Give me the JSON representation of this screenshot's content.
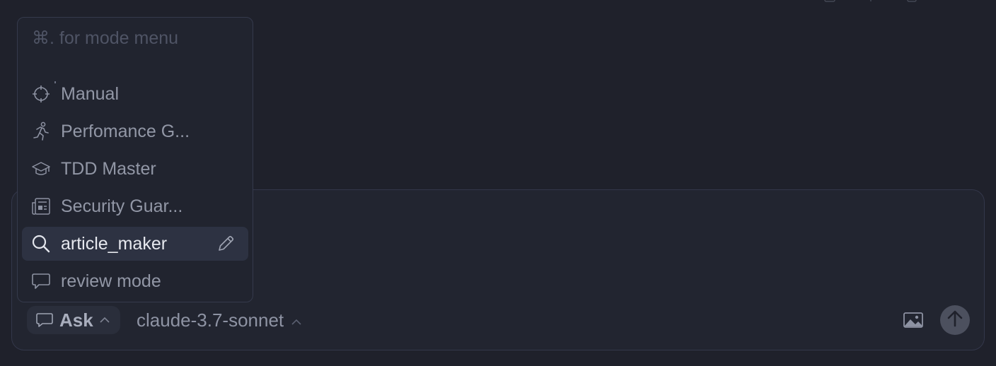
{
  "mode_menu": {
    "hint": "⌘. for mode menu",
    "items": [
      {
        "label": "Manual",
        "icon": "crosshair-icon"
      },
      {
        "label": "Perfomance G...",
        "icon": "running-person-icon"
      },
      {
        "label": "TDD Master",
        "icon": "graduation-cap-icon"
      },
      {
        "label": "Security Guar...",
        "icon": "newspaper-icon"
      },
      {
        "label": "article_maker",
        "icon": "search-icon",
        "selected": true,
        "action_icon": "pencil-icon"
      },
      {
        "label": "review mode",
        "icon": "chat-bubble-icon"
      }
    ]
  },
  "composer": {
    "mode_label": "Ask",
    "mode_icon": "chat-bubble-icon",
    "model_label": "claude-3.7-sonnet",
    "attach_icon": "image-icon",
    "send_icon": "arrow-up-icon"
  },
  "colors": {
    "background": "#1f212b",
    "panel": "#222530",
    "selected_row": "#2d3242",
    "send_button": "#4c505e"
  }
}
